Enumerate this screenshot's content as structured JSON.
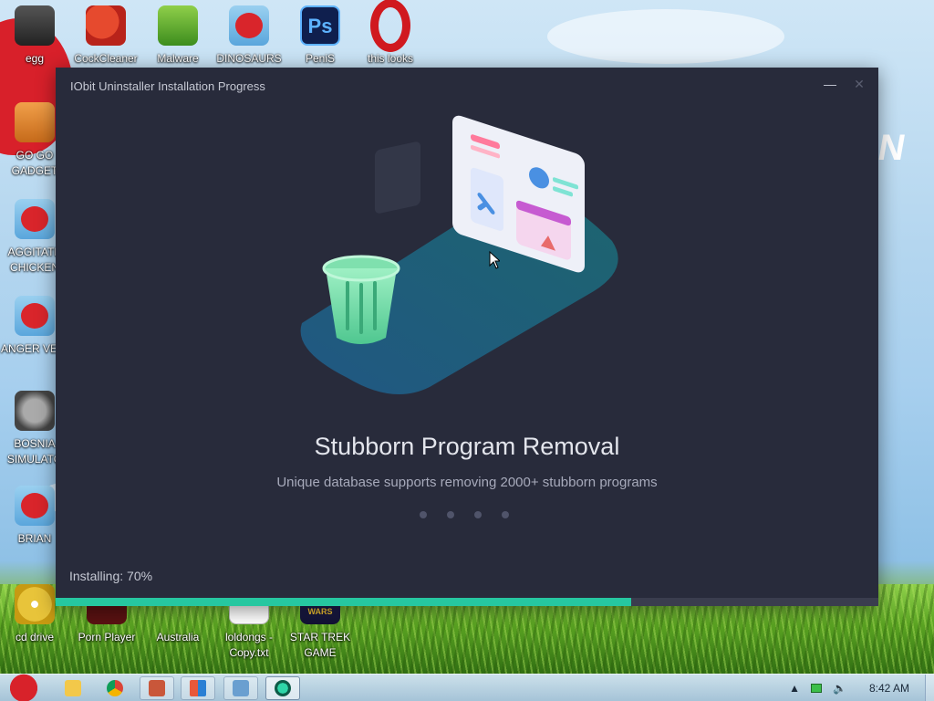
{
  "desktop": {
    "icons": [
      {
        "label": "egg",
        "icon": "recycle-bin-icon"
      },
      {
        "label": "CockCleaner",
        "icon": "ccleaner-icon"
      },
      {
        "label": "Malware",
        "icon": "shield-icon"
      },
      {
        "label": "DINOSAURS",
        "icon": "angry-bird-icon"
      },
      {
        "label": "PeniS",
        "icon": "photoshop-icon"
      },
      {
        "label": "this looks",
        "icon": "opera-icon"
      },
      {
        "label": "GO GO GADGET",
        "icon": "briefcase-icon"
      },
      {
        "label": "AGGITATE CHICKEN",
        "icon": "angry-bird-icon"
      },
      {
        "label": "ANGER VEIN",
        "icon": "angry-bird-icon"
      },
      {
        "label": "BOSNIA SIMULATO",
        "icon": "spiked-mine-icon"
      },
      {
        "label": "BRIAN",
        "icon": "angry-bird-icon"
      },
      {
        "label": "cd drive",
        "icon": "cd-drive-icon"
      },
      {
        "label": "Porn Player",
        "icon": "media-player-icon"
      },
      {
        "label": "Australia",
        "icon": "folder-icon"
      },
      {
        "label": "loldongs - Copy.txt",
        "icon": "text-file-icon"
      },
      {
        "label": "STAR TREK GAME",
        "icon": "star-wars-icon"
      }
    ]
  },
  "window": {
    "title": "IObit Uninstaller Installation Progress",
    "minimize_glyph": "—",
    "close_glyph": "✕",
    "headline": "Stubborn Program Removal",
    "subline": "Unique database supports removing 2000+ stubborn programs",
    "carousel": {
      "count": 4,
      "active_index": 3
    },
    "status": "Installing: 70%",
    "progress": 0.7,
    "accent_color": "#26c7a0",
    "background_color": "#282b3b"
  },
  "taskbar": {
    "pinned": [
      "explorer-icon",
      "chrome-icon"
    ],
    "apps": [
      "paint-icon",
      "windows-app-icon",
      "network-app-icon",
      "iobit-uninstaller-icon"
    ],
    "active_app": "iobit-uninstaller-icon",
    "tray_icons": [
      "show-hidden-icons-icon",
      "battery-icon",
      "volume-icon"
    ],
    "clock": "8:42 AM"
  }
}
